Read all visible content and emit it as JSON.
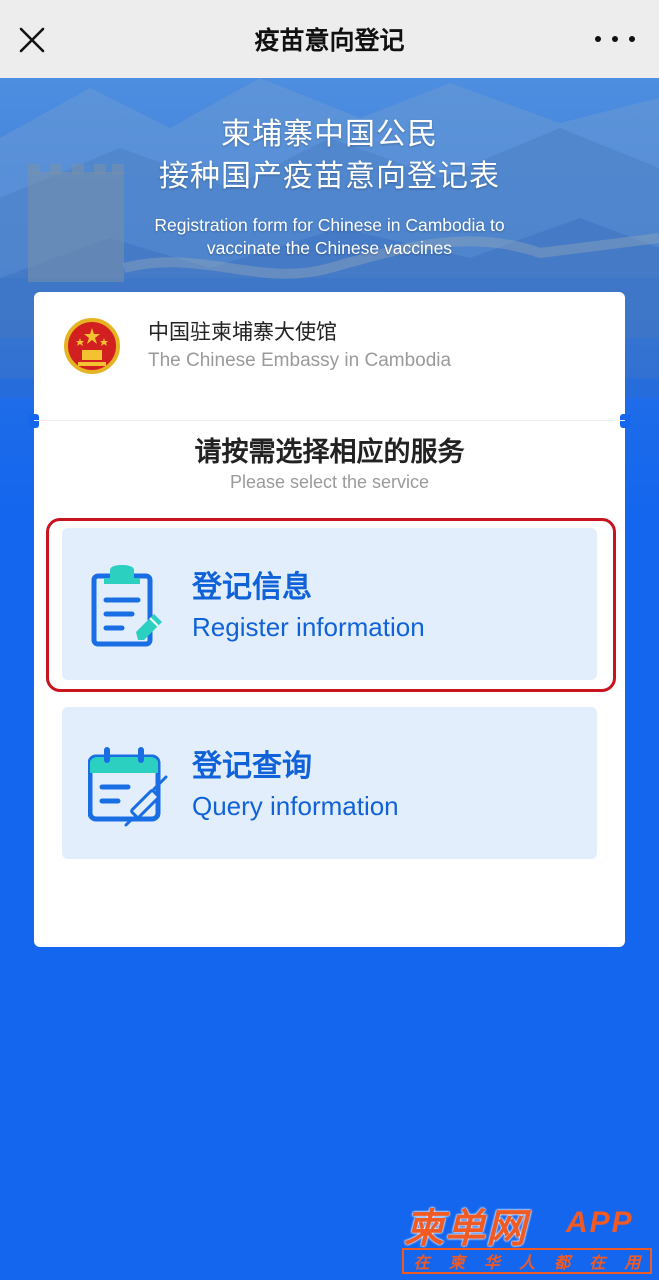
{
  "topbar": {
    "title": "疫苗意向登记",
    "close_icon": "close-icon",
    "more_icon": "more-icon"
  },
  "hero": {
    "title_line1": "柬埔寨中国公民",
    "title_line2": "接种国产疫苗意向登记表",
    "subtitle_line1": "Registration form for Chinese in Cambodia to",
    "subtitle_line2": "vaccinate the Chinese vaccines"
  },
  "card": {
    "org_name_cn": "中国驻柬埔寨大使馆",
    "org_name_en": "The Chinese Embassy in Cambodia",
    "prompt_cn": "请按需选择相应的服务",
    "prompt_en": "Please select the service",
    "services": [
      {
        "label_cn": "登记信息",
        "label_en": "Register information",
        "icon": "clipboard-edit-icon"
      },
      {
        "label_cn": "登记查询",
        "label_en": "Query information",
        "icon": "calendar-syringe-icon"
      }
    ]
  },
  "watermark": {
    "logo": "柬单网",
    "app": "APP",
    "slogan": [
      "在",
      "柬",
      "华",
      "人",
      "都",
      "在",
      "用"
    ]
  },
  "colors": {
    "background": "#1466ee",
    "accent": "#1062d8",
    "service_bg": "#e3eefc",
    "highlight": "#c8141e",
    "watermark": "#f05a24"
  }
}
